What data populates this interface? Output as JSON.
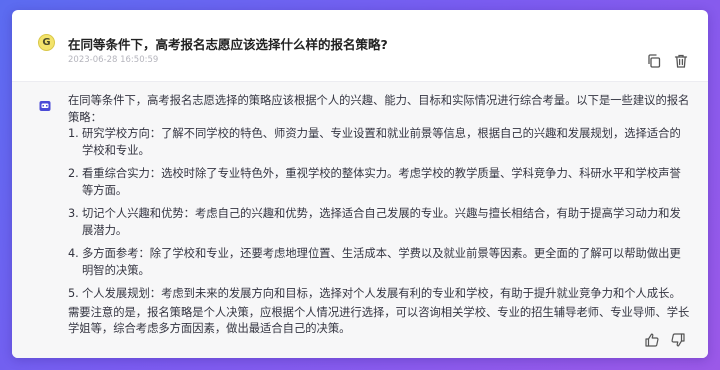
{
  "question": {
    "avatar_letter": "G",
    "text": "在同等条件下，高考报名志愿应该选择什么样的报名策略?",
    "timestamp": "2023-06-28 16:50:59",
    "actions": [
      "copy-icon",
      "trash-icon"
    ]
  },
  "answer": {
    "intro": "在同等条件下，高考报名志愿选择的策略应该根据个人的兴趣、能力、目标和实际情况进行综合考量。以下是一些建议的报名策略：",
    "items": [
      {
        "num": "1.",
        "text": "研究学校方向：了解不同学校的特色、师资力量、专业设置和就业前景等信息，根据自己的兴趣和发展规划，选择适合的学校和专业。"
      },
      {
        "num": "2.",
        "text": "看重综合实力：选校时除了专业特色外，重视学校的整体实力。考虑学校的教学质量、学科竞争力、科研水平和学校声誉等方面。"
      },
      {
        "num": "3.",
        "text": "切记个人兴趣和优势：考虑自己的兴趣和优势，选择适合自己发展的专业。兴趣与擅长相结合，有助于提高学习动力和发展潜力。"
      },
      {
        "num": "4.",
        "text": "多方面参考：除了学校和专业，还要考虑地理位置、生活成本、学费以及就业前景等因素。更全面的了解可以帮助做出更明智的决策。"
      },
      {
        "num": "5.",
        "text": "个人发展规划：考虑到未来的发展方向和目标，选择对个人发展有利的专业和学校，有助于提升就业竞争力和个人成长。"
      }
    ],
    "note": "需要注意的是，报名策略是个人决策，应根据个人情况进行选择，可以咨询相关学校、专业的招生辅导老师、专业导师、学长学姐等，综合考虑多方面因素，做出最适合自己的决策。",
    "actions": [
      "thumbs-up-icon",
      "thumbs-down-icon"
    ]
  },
  "colors": {
    "background_gradient": [
      "#5b6cf0",
      "#9b59e8"
    ],
    "avatar": "#f3e36b",
    "answer_bg": "#f7f7f8",
    "text": "#343541"
  }
}
